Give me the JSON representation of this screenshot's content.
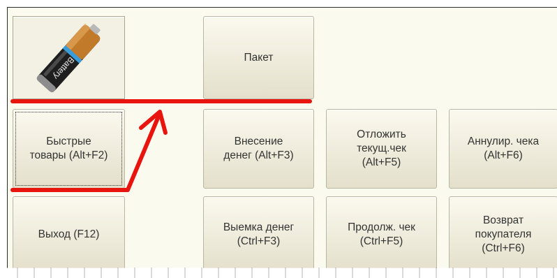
{
  "battery_tile": {
    "icon": "battery-icon",
    "label": "Battery"
  },
  "buttons": {
    "paket": "Пакет",
    "quick_goods": "Быстрые\nтовары (Alt+F2)",
    "deposit": "Внесение\nденег (Alt+F3)",
    "defer_check": "Отложить\nтекущ.чек\n(Alt+F5)",
    "cancel_check": "Аннулир. чека\n(Alt+F6)",
    "exit": "Выход (F12)",
    "withdraw": "Выемка денег\n(Ctrl+F3)",
    "continue_check": "Продолж. чек\n(Ctrl+F5)",
    "customer_return": "Возврат\nпокупателя\n(Ctrl+F6)"
  },
  "annotation": {
    "color": "#e8150f"
  }
}
